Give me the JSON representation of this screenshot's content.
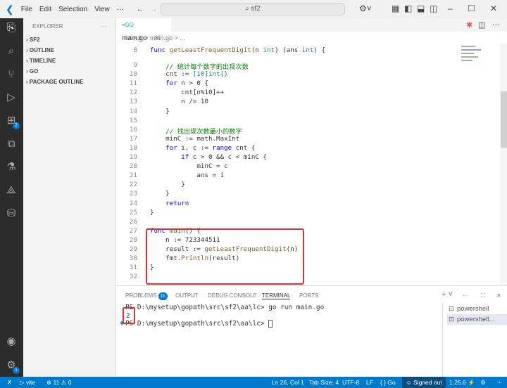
{
  "titlebar": {
    "menus": [
      "File",
      "Edit",
      "Selection",
      "View",
      "···"
    ],
    "search": "sf2"
  },
  "sidebar": {
    "title": "EXPLORER",
    "items": [
      "SF2",
      "OUTLINE",
      "TIMELINE",
      "GO",
      "PACKAGE OUTLINE"
    ]
  },
  "activity": {
    "extensions_badge": "2",
    "settings_badge": "1"
  },
  "editor": {
    "tab": "main.go",
    "breadcrumb": "aa > lc > main.go > ...",
    "lines": [
      {
        "n": "8",
        "t": [
          [
            "func ",
            "kw"
          ],
          [
            "getLeastFrequentDigit",
            "fn"
          ],
          [
            "(n ",
            "pl"
          ],
          [
            "int",
            "ty"
          ],
          [
            ") (ans ",
            "pl"
          ],
          [
            "int",
            "ty"
          ],
          [
            ") {",
            "pl"
          ]
        ]
      },
      {
        "n": "9",
        "t": [
          [
            "    // 统计每个数字的出现次数",
            "cm"
          ]
        ]
      },
      {
        "n": "10",
        "t": [
          [
            "    cnt := ",
            "pl"
          ],
          [
            "[10]int{}",
            "ty"
          ]
        ]
      },
      {
        "n": "11",
        "t": [
          [
            "    for",
            "kw"
          ],
          [
            " n > 0 {",
            "pl"
          ]
        ]
      },
      {
        "n": "12",
        "t": [
          [
            "        cnt[n%10]++",
            "pl"
          ]
        ]
      },
      {
        "n": "13",
        "t": [
          [
            "        n /= 10",
            "pl"
          ]
        ]
      },
      {
        "n": "14",
        "t": [
          [
            "    }",
            "pl"
          ]
        ]
      },
      {
        "n": "15",
        "t": [
          [
            "",
            "pl"
          ]
        ]
      },
      {
        "n": "16",
        "t": [
          [
            "    // 找出现次数最小的数字",
            "cm"
          ]
        ]
      },
      {
        "n": "17",
        "t": [
          [
            "    minC := math.MaxInt",
            "pl"
          ]
        ]
      },
      {
        "n": "18",
        "t": [
          [
            "    for",
            "kw"
          ],
          [
            " i, c := ",
            "pl"
          ],
          [
            "range",
            "kw"
          ],
          [
            " cnt {",
            "pl"
          ]
        ]
      },
      {
        "n": "19",
        "t": [
          [
            "        if",
            "kw"
          ],
          [
            " c > 0 && c < minC {",
            "pl"
          ]
        ]
      },
      {
        "n": "20",
        "t": [
          [
            "            minC = c",
            "pl"
          ]
        ]
      },
      {
        "n": "21",
        "t": [
          [
            "            ans = i",
            "pl"
          ]
        ]
      },
      {
        "n": "22",
        "t": [
          [
            "        }",
            "pl"
          ]
        ]
      },
      {
        "n": "23",
        "t": [
          [
            "    }",
            "pl"
          ]
        ]
      },
      {
        "n": "24",
        "t": [
          [
            "    return",
            "kw"
          ]
        ]
      },
      {
        "n": "25",
        "t": [
          [
            "}",
            "pl"
          ]
        ]
      },
      {
        "n": "26",
        "t": [
          [
            "",
            "pl"
          ]
        ]
      },
      {
        "n": "27",
        "t": [
          [
            "func ",
            "kw"
          ],
          [
            "main",
            "fn"
          ],
          [
            "() {",
            "pl"
          ]
        ]
      },
      {
        "n": "28",
        "t": [
          [
            "    n := 723344511",
            "pl"
          ]
        ]
      },
      {
        "n": "29",
        "t": [
          [
            "    result := ",
            "pl"
          ],
          [
            "getLeastFrequentDigit",
            "fn"
          ],
          [
            "(n)",
            "pl"
          ]
        ]
      },
      {
        "n": "30",
        "t": [
          [
            "    fmt.",
            "pl"
          ],
          [
            "Println",
            "fn"
          ],
          [
            "(result)",
            "pl"
          ]
        ]
      },
      {
        "n": "31",
        "t": [
          [
            "}",
            "pl"
          ]
        ]
      },
      {
        "n": "32",
        "t": [
          [
            "",
            "pl"
          ]
        ]
      }
    ]
  },
  "panel": {
    "tabs": [
      "PROBLEMS",
      "OUTPUT",
      "DEBUG CONSOLE",
      "TERMINAL",
      "PORTS"
    ],
    "problems_count": "11",
    "terminal": [
      "PS D:\\mysetup\\gopath\\src\\sf2\\aa\\lc> go run main.go",
      "2",
      "PS D:\\mysetup\\gopath\\src\\sf2\\aa\\lc> "
    ],
    "terminals": [
      "powershell",
      "powershell..."
    ]
  },
  "status": {
    "vite": "vite",
    "errors": "11",
    "warnings": "0",
    "position": "Ln 26, Col 1",
    "tabsize": "Tab Size: 4",
    "encoding": "UTF-8",
    "eol": "LF",
    "lang": "{ } Go",
    "signed": "Signed out",
    "version": "1.25.6"
  }
}
